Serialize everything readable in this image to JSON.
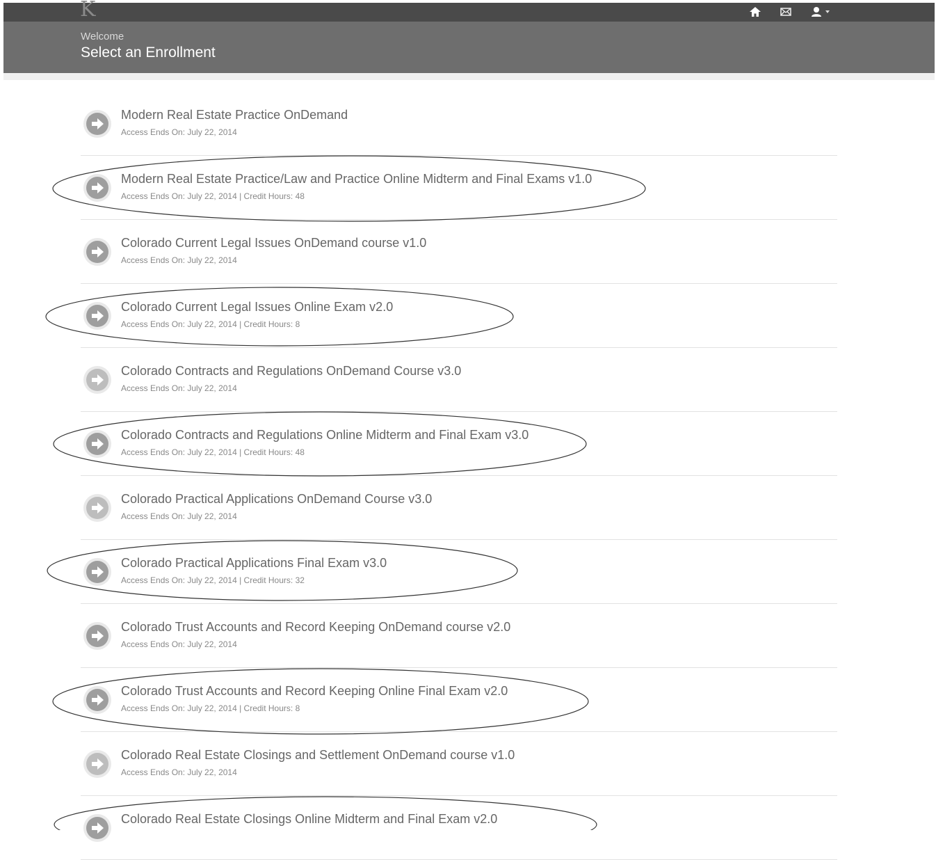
{
  "topbar": {
    "logo_text": "K",
    "icons": [
      "home-icon",
      "mail-icon",
      "user-icon",
      "caret-down-icon"
    ]
  },
  "header": {
    "welcome": "Welcome",
    "title": "Select an Enrollment"
  },
  "enrollments": [
    {
      "title": "Modern Real Estate Practice OnDemand",
      "meta": "Access Ends On: July 22, 2014",
      "circled": false
    },
    {
      "title": "Modern Real Estate Practice/Law and Practice Online Midterm and Final Exams v1.0",
      "meta": "Access Ends On: July 22, 2014 | Credit Hours: 48",
      "circled": true
    },
    {
      "title": "Colorado Current Legal Issues OnDemand course v1.0",
      "meta": "Access Ends On: July 22, 2014",
      "circled": false
    },
    {
      "title": "Colorado Current Legal Issues Online Exam v2.0",
      "meta": "Access Ends On: July 22, 2014 | Credit Hours: 8",
      "circled": true
    },
    {
      "title": "Colorado Contracts and Regulations OnDemand Course v3.0",
      "meta": "Access Ends On: July 22, 2014",
      "circled": false
    },
    {
      "title": "Colorado Contracts and Regulations Online Midterm and Final Exam v3.0",
      "meta": "Access Ends On: July 22, 2014 | Credit Hours: 48",
      "circled": true
    },
    {
      "title": "Colorado Practical Applications OnDemand Course v3.0",
      "meta": "Access Ends On: July 22, 2014",
      "circled": false
    },
    {
      "title": "Colorado Practical Applications Final Exam v3.0",
      "meta": "Access Ends On: July 22, 2014 | Credit Hours: 32",
      "circled": true
    },
    {
      "title": "Colorado Trust Accounts and Record Keeping OnDemand course v2.0",
      "meta": "Access Ends On: July 22, 2014",
      "circled": false
    },
    {
      "title": "Colorado Trust Accounts and Record Keeping Online Final Exam v2.0",
      "meta": "Access Ends On: July 22, 2014 | Credit Hours: 8",
      "circled": true
    },
    {
      "title": "Colorado Real Estate Closings and Settlement OnDemand course v1.0",
      "meta": "Access Ends On: July 22, 2014",
      "circled": false
    },
    {
      "title": "Colorado Real Estate Closings Online Midterm and Final Exam v2.0",
      "meta": "",
      "circled": true
    }
  ]
}
